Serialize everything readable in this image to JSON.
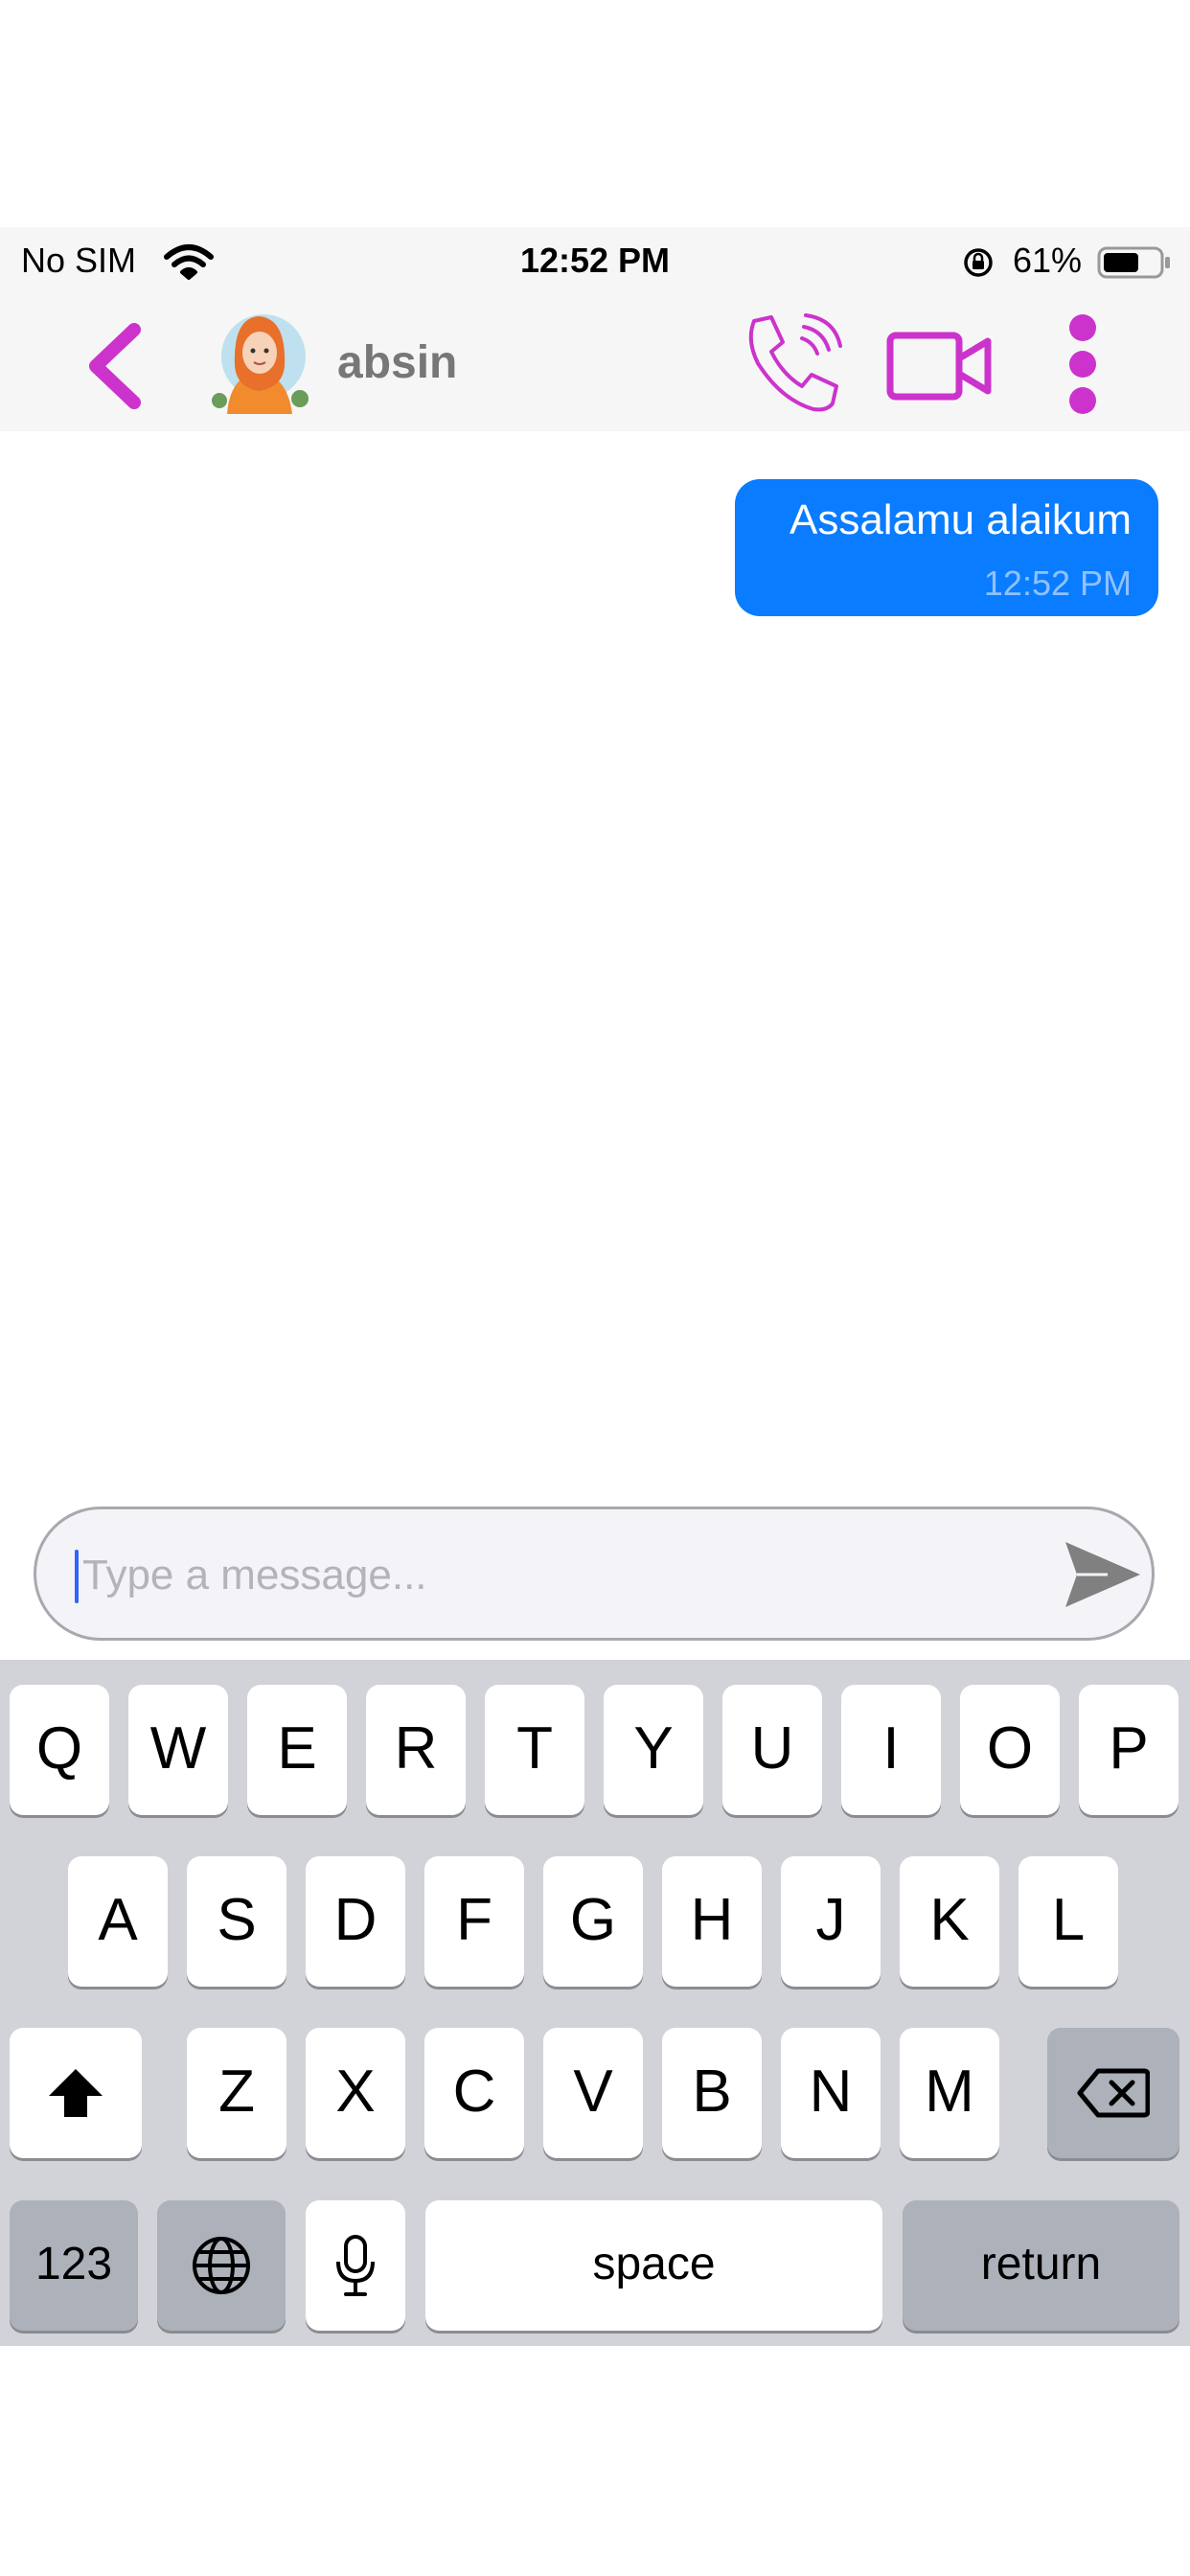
{
  "status_bar": {
    "carrier": "No SIM",
    "time": "12:52 PM",
    "battery_percent": "61%",
    "battery_level": 0.61
  },
  "header": {
    "contact_name": "absin",
    "icons": [
      "back-chevron-icon",
      "avatar",
      "phone-call-icon",
      "video-camera-icon",
      "more-vertical-icon"
    ],
    "accent_color": "#cc33cc"
  },
  "messages": [
    {
      "direction": "outgoing",
      "text": "Assalamu alaikum",
      "time": "12:52 PM",
      "bubble_color": "#0a7cff"
    }
  ],
  "composer": {
    "placeholder": "Type a message...",
    "value": "",
    "send_icon": "send-icon"
  },
  "keyboard": {
    "row1": [
      "Q",
      "W",
      "E",
      "R",
      "T",
      "Y",
      "U",
      "I",
      "O",
      "P"
    ],
    "row2": [
      "A",
      "S",
      "D",
      "F",
      "G",
      "H",
      "J",
      "K",
      "L"
    ],
    "row3": [
      "Z",
      "X",
      "C",
      "V",
      "B",
      "N",
      "M"
    ],
    "numbers_label": "123",
    "space_label": "space",
    "return_label": "return"
  }
}
